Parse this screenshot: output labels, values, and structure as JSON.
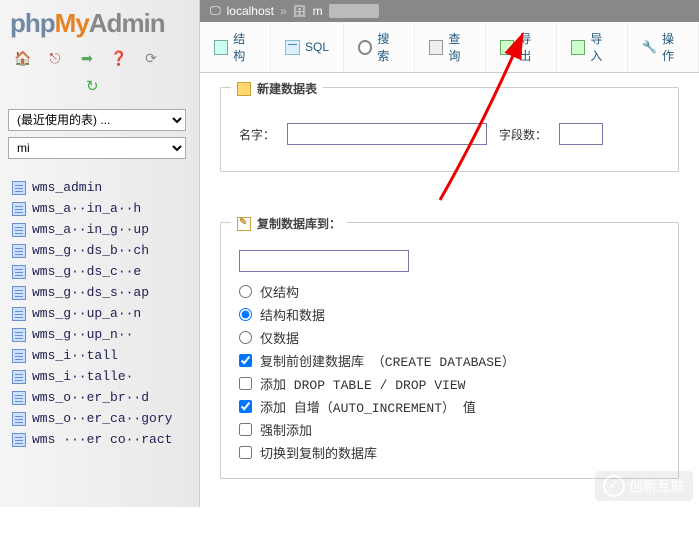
{
  "logo": {
    "p1": "php",
    "p2": "My",
    "p3": "Admin"
  },
  "nav_icons": {
    "home": "🏠",
    "exit": "⎋",
    "sql": "➡",
    "help": "❓",
    "reload": "⟳",
    "refresh": "↻"
  },
  "selects": {
    "recent": "(最近使用的表) ...",
    "db": "mi"
  },
  "tables": [
    "wms_admin",
    "wms_a··in_a··h",
    "wms_a··in_g··up",
    "wms_g··ds_b··ch",
    "wms_g··ds_c··e",
    "wms_g··ds_s··ap",
    "wms_g··up_a··n",
    "wms_g··up_n··",
    "wms_i··tall",
    "wms_i··talle·",
    "wms_o··er_br··d",
    "wms_o··er_ca··gory",
    "wms ···er co··ract"
  ],
  "breadcrumb": {
    "host": "localhost",
    "sep": "»",
    "db_prefix": "m"
  },
  "tabs": {
    "structure": "结构",
    "sql": "SQL",
    "search": "搜索",
    "query": "查询",
    "export": "导出",
    "import": "导入",
    "operations": "操作"
  },
  "panel_create": {
    "legend": "新建数据表",
    "name_label": "名字：",
    "fields_label": "字段数："
  },
  "panel_copy": {
    "legend": "复制数据库到：",
    "opt_struct_only": "仅结构",
    "opt_struct_data": "结构和数据",
    "opt_data_only": "仅数据",
    "opt_create_db": "复制前创建数据库 （CREATE DATABASE）",
    "opt_drop": "添加 DROP TABLE / DROP VIEW",
    "opt_autoinc": "添加 自增（AUTO_INCREMENT） 值",
    "opt_force": "强制添加",
    "opt_switch": "切换到复制的数据库"
  },
  "radio_selected": "opt_struct_data",
  "checks": {
    "opt_create_db": true,
    "opt_drop": false,
    "opt_autoinc": true,
    "opt_force": false,
    "opt_switch": false
  },
  "watermark": "创新互联"
}
